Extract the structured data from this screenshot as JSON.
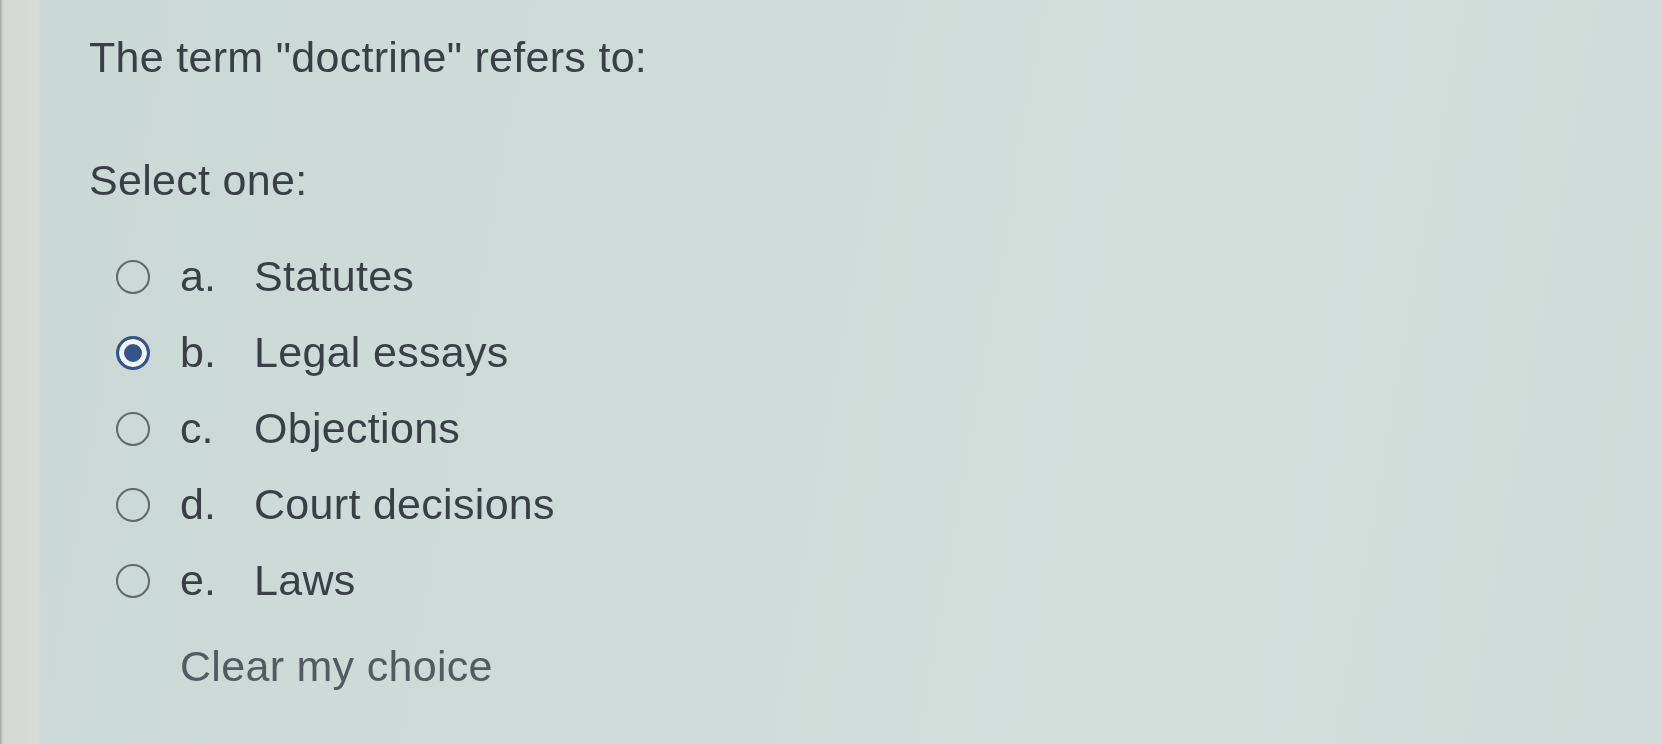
{
  "question": {
    "text": "The term \"doctrine\" refers to:",
    "prompt": "Select one:",
    "options": [
      {
        "letter": "a.",
        "text": "Statutes",
        "selected": false
      },
      {
        "letter": "b.",
        "text": "Legal essays",
        "selected": true
      },
      {
        "letter": "c.",
        "text": "Objections",
        "selected": false
      },
      {
        "letter": "d.",
        "text": "Court decisions",
        "selected": false
      },
      {
        "letter": "e.",
        "text": "Laws",
        "selected": false
      }
    ],
    "clear_choice": "Clear my choice"
  }
}
